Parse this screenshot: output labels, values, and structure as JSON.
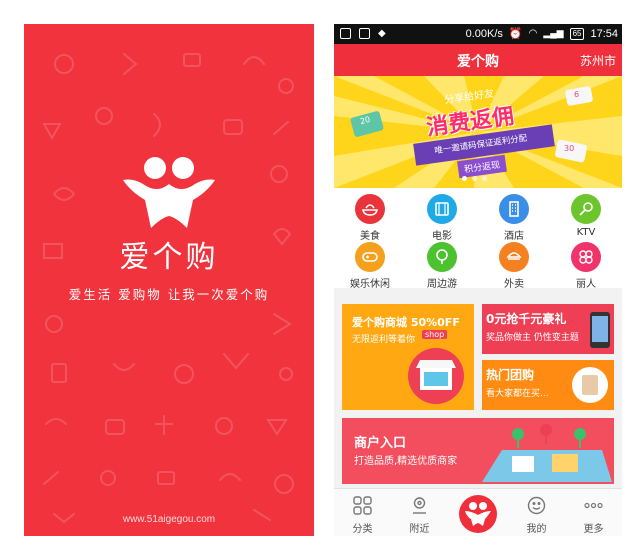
{
  "splash": {
    "app_name": "爱个购",
    "slogan": "爱生活 爱购物 让我一次爱个购",
    "url": "www.51aigegou.com",
    "background_color": "#f0333d"
  },
  "status_bar": {
    "speed": "0.00K/s",
    "battery": "65",
    "time": "17:54"
  },
  "app_bar": {
    "title": "爱个购",
    "city": "苏州市",
    "color": "#ef2f3b"
  },
  "banner": {
    "line1": "分享给好友",
    "line2": "消费返佣",
    "line3": "唯一邀请码保证返利分配",
    "line4": "积分返现",
    "tag_left": "20",
    "tag_right": "30",
    "tag_top_right": "6"
  },
  "categories": [
    {
      "label": "美食",
      "icon": "food-icon",
      "color": "#e8343a"
    },
    {
      "label": "电影",
      "icon": "film-icon",
      "color": "#1fa9e8"
    },
    {
      "label": "酒店",
      "icon": "hotel-icon",
      "color": "#3a8ee8"
    },
    {
      "label": "KTV",
      "icon": "microphone-icon",
      "color": "#6cc52d"
    },
    {
      "label": "娱乐休闲",
      "icon": "gamepad-icon",
      "color": "#f5a11d"
    },
    {
      "label": "周边游",
      "icon": "tree-icon",
      "color": "#4cc22e"
    },
    {
      "label": "外卖",
      "icon": "takeaway-icon",
      "color": "#f58020"
    },
    {
      "label": "丽人",
      "icon": "beauty-icon",
      "color": "#f0336a"
    }
  ],
  "promos": {
    "mall": {
      "title": "爱个购商城 50%0FF",
      "subtitle": "无限返利等着你",
      "badge": "shop"
    },
    "zero": {
      "title": "0元抢千元豪礼",
      "subtitle": "奖品你做主 仍性变主题"
    },
    "group": {
      "title": "热门团购",
      "subtitle": "看大家都在买..."
    },
    "merchant": {
      "title": "商户入口",
      "subtitle": "打造品质,精选优质商家"
    }
  },
  "bottom_nav": [
    {
      "label": "分类",
      "icon": "grid-icon"
    },
    {
      "label": "附近",
      "icon": "location-icon"
    },
    {
      "label": "",
      "icon": "logo-icon"
    },
    {
      "label": "我的",
      "icon": "smiley-icon"
    },
    {
      "label": "更多",
      "icon": "more-dots-icon"
    }
  ]
}
